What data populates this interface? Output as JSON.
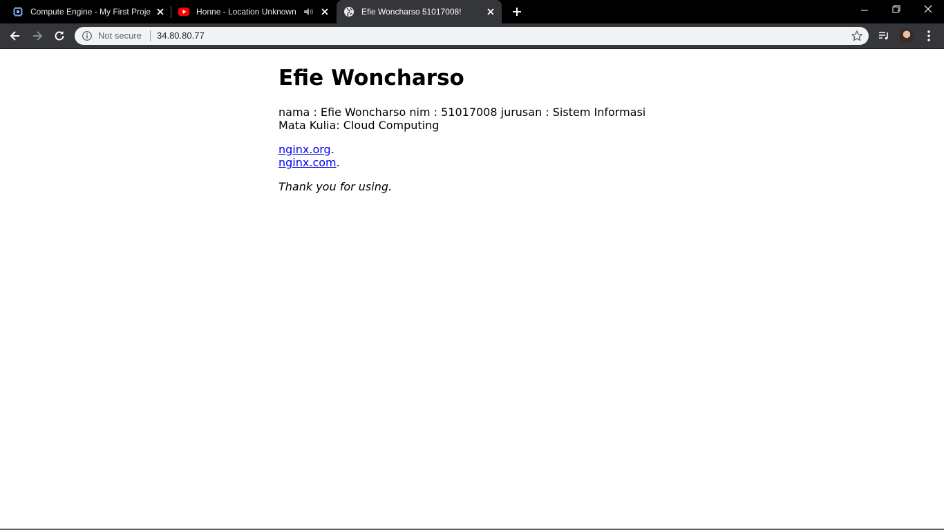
{
  "browser": {
    "tabs": [
      {
        "title": "Compute Engine - My First Proje",
        "icon": "compute-engine-icon",
        "active": false
      },
      {
        "title": "Honne - Location Unknown",
        "icon": "youtube-icon",
        "audio": true,
        "active": false
      },
      {
        "title": "Efie Woncharso 51017008!",
        "icon": "globe-icon",
        "active": true
      }
    ],
    "omnibox": {
      "security_label": "Not secure",
      "url": "34.80.80.77"
    }
  },
  "page": {
    "heading": "Efie Woncharso",
    "paragraph": "nama : Efie Woncharso nim : 51017008 jurusan : Sistem Informasi Mata Kulia: Cloud Computing",
    "links": [
      {
        "text": "nginx.org",
        "suffix": "."
      },
      {
        "text": "nginx.com",
        "suffix": "."
      }
    ],
    "thanks": "Thank you for using."
  },
  "colors": {
    "tabstrip": "#000000",
    "toolbar": "#35363a",
    "omnibox": "#f1f3f4",
    "link": "#0000ee"
  }
}
